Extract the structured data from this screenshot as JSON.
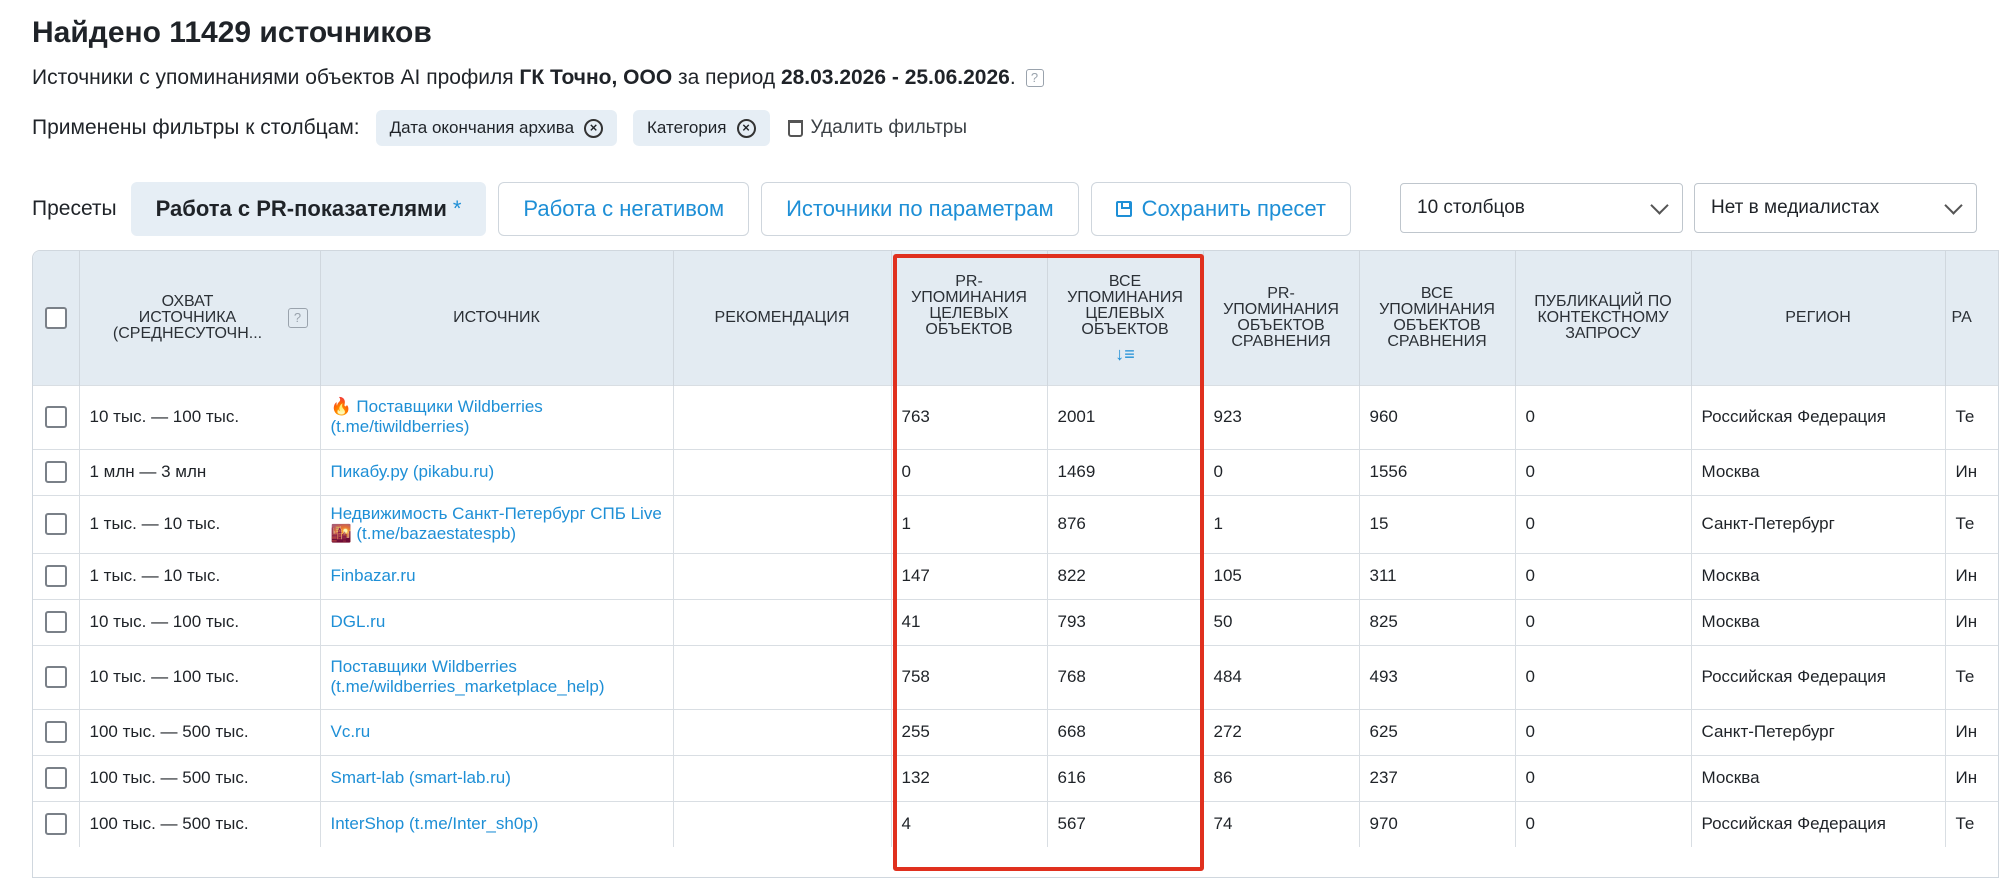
{
  "header": {
    "title": "Найдено 11429 источников",
    "subtitle_prefix": "Источники с упоминаниями объектов AI профиля",
    "profile_name": "ГК Точно, ООО",
    "period_prefix": "за период",
    "period": "28.03.2026 - 25.06.2026",
    "period_suffix": ".",
    "help_glyph": "?"
  },
  "filters": {
    "label": "Применены фильтры к столбцам:",
    "chips": [
      "Дата окончания архива",
      "Категория"
    ],
    "remove_glyph": "⊗",
    "delete_label": "Удалить фильтры"
  },
  "presets": {
    "label": "Пресеты",
    "items": [
      {
        "label": "Работа с PR-показателями",
        "active": true,
        "suffix": "*"
      },
      {
        "label": "Работа с негативом",
        "active": false
      },
      {
        "label": "Источники по параметрам",
        "active": false
      }
    ],
    "save_label": "Сохранить пресет"
  },
  "selects": {
    "columns": "10 столбцов",
    "media": "Нет в медиалистах"
  },
  "table": {
    "headers": [
      "ОХВАТ ИСТОЧНИКА (СРЕДНЕСУТОЧН...",
      "ИСТОЧНИК",
      "РЕКОМЕНДАЦИЯ",
      "PR-УПОМИНАНИЯ ЦЕЛЕВЫХ ОБЪЕКТОВ",
      "ВСЕ УПОМИНАНИЯ ЦЕЛЕВЫХ ОБЪЕКТОВ",
      "PR-УПОМИНАНИЯ ОБЪЕКТОВ СРАВНЕНИЯ",
      "ВСЕ УПОМИНАНИЯ ОБЪЕКТОВ СРАВНЕНИЯ",
      "ПУБЛИКАЦИЙ ПО КОНТЕКСТНОМУ ЗАПРОСУ",
      "РЕГИОН",
      "РА"
    ],
    "sort_glyph": "↓≡",
    "rows": [
      {
        "reach": "10 тыс. — 100 тыс.",
        "source": "🔥 Поставщики Wildberries (t.me/tiwildberries)",
        "rec": "",
        "pr_target": "763",
        "all_target": "2001",
        "pr_comp": "923",
        "all_comp": "960",
        "context": "0",
        "region": "Российская Федерация",
        "extra": "Те"
      },
      {
        "reach": "1 млн — 3 млн",
        "source": "Пикабу.ру (pikabu.ru)",
        "rec": "",
        "pr_target": "0",
        "all_target": "1469",
        "pr_comp": "0",
        "all_comp": "1556",
        "context": "0",
        "region": "Москва",
        "extra": "Ин"
      },
      {
        "reach": "1 тыс. — 10 тыс.",
        "source": "Недвижимость Санкт-Петербург СПБ Live 🌇 (t.me/bazaestatespb)",
        "rec": "",
        "pr_target": "1",
        "all_target": "876",
        "pr_comp": "1",
        "all_comp": "15",
        "context": "0",
        "region": "Санкт-Петербург",
        "extra": "Те"
      },
      {
        "reach": "1 тыс. — 10 тыс.",
        "source": "Finbazar.ru",
        "rec": "",
        "pr_target": "147",
        "all_target": "822",
        "pr_comp": "105",
        "all_comp": "311",
        "context": "0",
        "region": "Москва",
        "extra": "Ин"
      },
      {
        "reach": "10 тыс. — 100 тыс.",
        "source": "DGL.ru",
        "rec": "",
        "pr_target": "41",
        "all_target": "793",
        "pr_comp": "50",
        "all_comp": "825",
        "context": "0",
        "region": "Москва",
        "extra": "Ин"
      },
      {
        "reach": "10 тыс. — 100 тыс.",
        "source": "Поставщики Wildberries (t.me/wildberries_marketplace_help)",
        "rec": "",
        "pr_target": "758",
        "all_target": "768",
        "pr_comp": "484",
        "all_comp": "493",
        "context": "0",
        "region": "Российская Федерация",
        "extra": "Те"
      },
      {
        "reach": "100 тыс. — 500 тыс.",
        "source": "Vc.ru",
        "rec": "",
        "pr_target": "255",
        "all_target": "668",
        "pr_comp": "272",
        "all_comp": "625",
        "context": "0",
        "region": "Санкт-Петербург",
        "extra": "Ин"
      },
      {
        "reach": "100 тыс. — 500 тыс.",
        "source": "Smart-lab (smart-lab.ru)",
        "rec": "",
        "pr_target": "132",
        "all_target": "616",
        "pr_comp": "86",
        "all_comp": "237",
        "context": "0",
        "region": "Москва",
        "extra": "Ин"
      },
      {
        "reach": "100 тыс. — 500 тыс.",
        "source": "InterShop (t.me/Inter_sh0p)",
        "rec": "",
        "pr_target": "4",
        "all_target": "567",
        "pr_comp": "74",
        "all_comp": "970",
        "context": "0",
        "region": "Российская Федерация",
        "extra": "Те"
      }
    ]
  },
  "colors": {
    "accent": "#1e8fd6",
    "header_bg": "#e3ebf2",
    "chip_bg": "#e6eef5",
    "highlight": "#e0301e"
  }
}
